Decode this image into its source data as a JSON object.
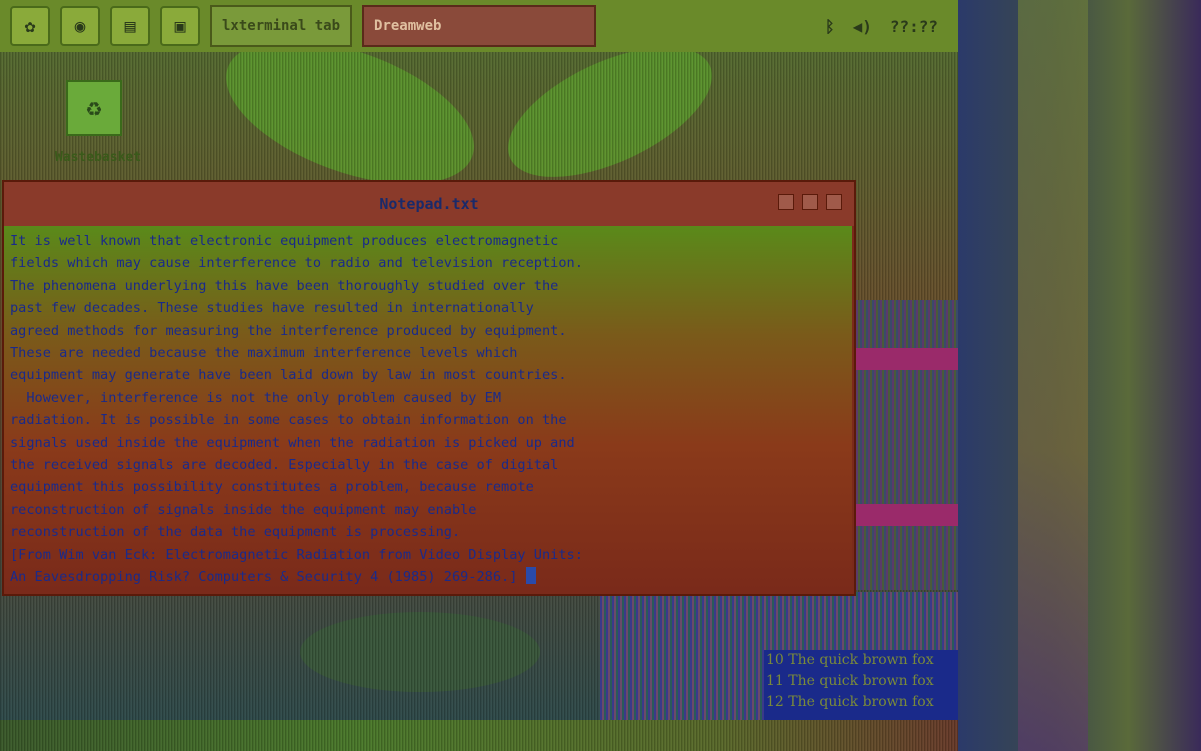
{
  "taskbar": {
    "icons": [
      {
        "name": "start-icon",
        "glyph": "✿"
      },
      {
        "name": "browser-icon",
        "glyph": "◉"
      },
      {
        "name": "files-icon",
        "glyph": "▤"
      },
      {
        "name": "terminal-icon",
        "glyph": "▣"
      }
    ],
    "tasks": [
      {
        "label": "lxterminal tab",
        "active": false
      },
      {
        "label": "Dreamweb",
        "active": true
      }
    ],
    "tray": {
      "bluetooth_glyph": "ᛒ",
      "volume_glyph": "◀)",
      "clock": "??:??"
    }
  },
  "desktop": {
    "icon": {
      "name": "trash-icon",
      "glyph": "♻",
      "label": "Wastebasket"
    }
  },
  "window": {
    "title": "Notepad.txt",
    "text": "It is well known that electronic equipment produces electromagnetic\nfields which may cause interference to radio and television reception.\nThe phenomena underlying this have been thoroughly studied over the\npast few decades. These studies have resulted in internationally\nagreed methods for measuring the interference produced by equipment.\nThese are needed because the maximum interference levels which\nequipment may generate have been laid down by law in most countries.\n  However, interference is not the only problem caused by EM\nradiation. It is possible in some cases to obtain information on the\nsignals used inside the equipment when the radiation is picked up and\nthe received signals are decoded. Especially in the case of digital\nequipment this possibility constitutes a problem, because remote\nreconstruction of signals inside the equipment may enable\nreconstruction of the data the equipment is processing.\n[From Wim van Eck: Electromagnetic Radiation from Video Display Units:\nAn Eavesdropping Risk? Computers & Security 4 (1985) 269-286.] "
  },
  "font_sample": {
    "lines": [
      "10 The quick brown fox",
      "11 The quick brown fox",
      "12 The quick brown fox"
    ]
  },
  "colors": {
    "text": "#1a2a8a",
    "window_bg": "#7a2a1a",
    "taskbar": "#6a8a2a"
  }
}
